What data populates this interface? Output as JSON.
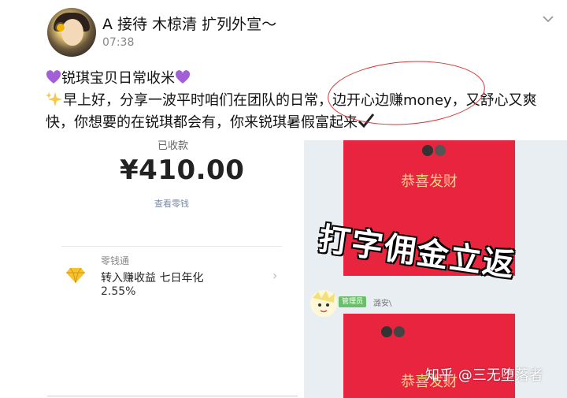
{
  "header": {
    "username": "A 接待 木椋清 扩列外宣～",
    "time": "07:38"
  },
  "post": {
    "line1": "锐琪宝贝日常收米",
    "line2": "早上好，分享一波平时咱们在团队的日常，边开心边赚money，又舒心又爽",
    "line3": "快，你想要的在锐琪都会有，你来锐琪暑假富起来"
  },
  "payment": {
    "received_label": "已收款",
    "amount": "¥410.00",
    "view_change": "查看零钱",
    "card_title": "零钱通",
    "card_line": "转入赚收益 七日年化",
    "rate": "2.55%"
  },
  "chat": {
    "packet1_text": "恭喜发财",
    "packet2_text": "恭喜发财",
    "badge": "管理员",
    "nick": "潞安\\",
    "banner": "打字佣金立返",
    "watermark": "知乎 @三无堕落者"
  },
  "colors": {
    "accent_red": "#e8243f",
    "gold_text": "#fbd488",
    "circle": "#dd3333"
  }
}
